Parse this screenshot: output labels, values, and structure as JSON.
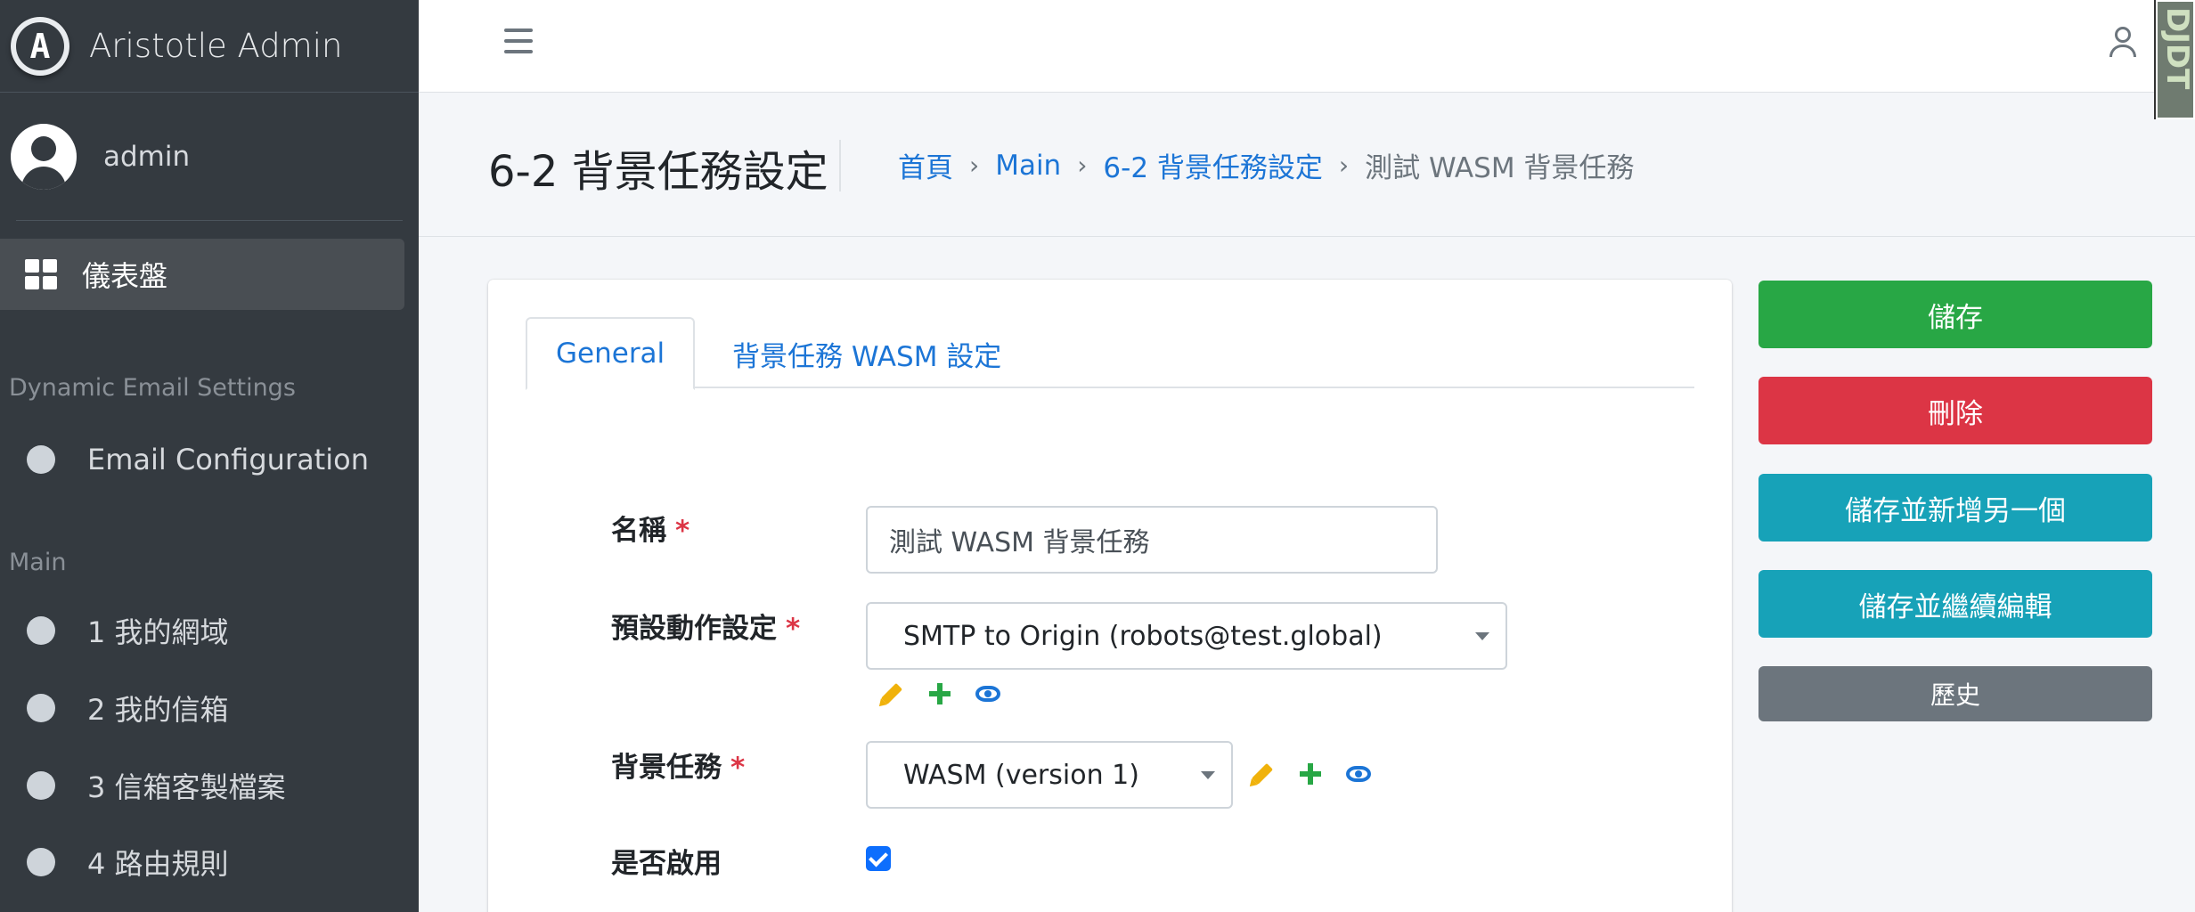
{
  "brand": {
    "name": "Aristotle Admin",
    "logo_letter": "A"
  },
  "user": {
    "name": "admin"
  },
  "sidebar": {
    "dashboard": "儀表盤",
    "header_email": "Dynamic Email Settings",
    "email_config": "Email Configuration",
    "header_main": "Main",
    "items": [
      "1 我的網域",
      "2 我的信箱",
      "3 信箱客製檔案",
      "4 路由規則"
    ]
  },
  "topbar": {
    "corner_badge": "DJDT"
  },
  "header": {
    "title": "6-2 背景任務設定",
    "breadcrumb": {
      "home": "首頁",
      "main": "Main",
      "section": "6-2 背景任務設定",
      "current": "測試 WASM 背景任務"
    }
  },
  "tabs": {
    "general": "General",
    "wasm": "背景任務 WASM 設定"
  },
  "form": {
    "name_label": "名稱",
    "name_value": "測試 WASM 背景任務",
    "default_action_label": "預設動作設定",
    "default_action_value": "SMTP to Origin (robots@test.global)",
    "task_label": "背景任務",
    "task_value": "WASM (version 1)",
    "enabled_label": "是否啟用",
    "required_mark": "*"
  },
  "actions": {
    "save": "儲存",
    "delete": "刪除",
    "save_add": "儲存並新增另一個",
    "save_continue": "儲存並繼續編輯",
    "history": "歷史"
  },
  "colors": {
    "sidebar_bg": "#343a40",
    "link": "#1c75d6",
    "success": "#28a745",
    "danger": "#dc3545",
    "info": "#17a2b8",
    "secondary": "#6c757d",
    "checkbox": "#0d6efd"
  },
  "icons": [
    "grid-icon",
    "user-icon",
    "menu-icon",
    "pencil-icon",
    "plus-icon",
    "eye-icon"
  ]
}
